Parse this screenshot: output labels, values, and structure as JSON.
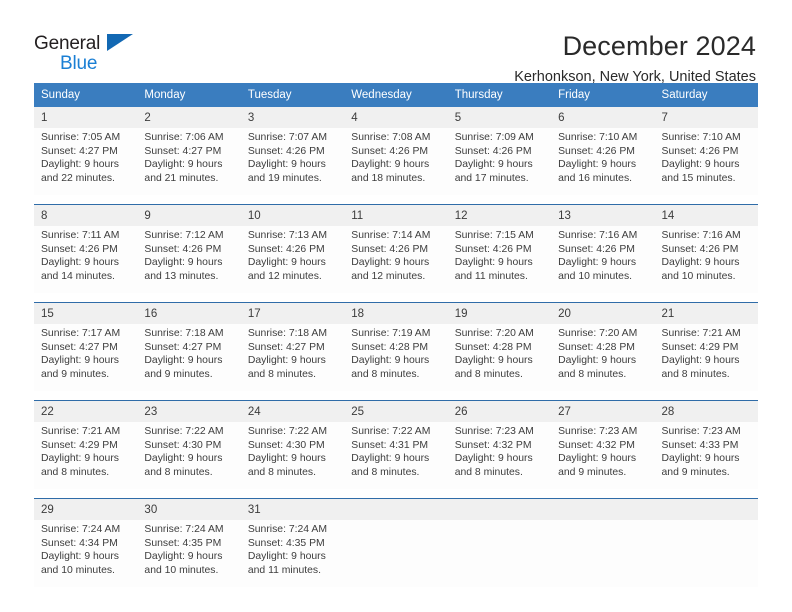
{
  "logo": {
    "line1": "General",
    "line2": "Blue",
    "triangle_color": "#1268b3"
  },
  "header": {
    "title": "December 2024",
    "location": "Kerhonkson, New York, United States"
  },
  "colors": {
    "header_blue": "#3a7dbf",
    "row_divider": "#2f6ca8",
    "daynum_band": "#f0f0f0",
    "text": "#3d3d3d"
  },
  "calendar": {
    "weekday_headers": [
      "Sunday",
      "Monday",
      "Tuesday",
      "Wednesday",
      "Thursday",
      "Friday",
      "Saturday"
    ],
    "weeks": [
      [
        {
          "day": "1",
          "sunrise": "Sunrise: 7:05 AM",
          "sunset": "Sunset: 4:27 PM",
          "daylight1": "Daylight: 9 hours",
          "daylight2": "and 22 minutes."
        },
        {
          "day": "2",
          "sunrise": "Sunrise: 7:06 AM",
          "sunset": "Sunset: 4:27 PM",
          "daylight1": "Daylight: 9 hours",
          "daylight2": "and 21 minutes."
        },
        {
          "day": "3",
          "sunrise": "Sunrise: 7:07 AM",
          "sunset": "Sunset: 4:26 PM",
          "daylight1": "Daylight: 9 hours",
          "daylight2": "and 19 minutes."
        },
        {
          "day": "4",
          "sunrise": "Sunrise: 7:08 AM",
          "sunset": "Sunset: 4:26 PM",
          "daylight1": "Daylight: 9 hours",
          "daylight2": "and 18 minutes."
        },
        {
          "day": "5",
          "sunrise": "Sunrise: 7:09 AM",
          "sunset": "Sunset: 4:26 PM",
          "daylight1": "Daylight: 9 hours",
          "daylight2": "and 17 minutes."
        },
        {
          "day": "6",
          "sunrise": "Sunrise: 7:10 AM",
          "sunset": "Sunset: 4:26 PM",
          "daylight1": "Daylight: 9 hours",
          "daylight2": "and 16 minutes."
        },
        {
          "day": "7",
          "sunrise": "Sunrise: 7:10 AM",
          "sunset": "Sunset: 4:26 PM",
          "daylight1": "Daylight: 9 hours",
          "daylight2": "and 15 minutes."
        }
      ],
      [
        {
          "day": "8",
          "sunrise": "Sunrise: 7:11 AM",
          "sunset": "Sunset: 4:26 PM",
          "daylight1": "Daylight: 9 hours",
          "daylight2": "and 14 minutes."
        },
        {
          "day": "9",
          "sunrise": "Sunrise: 7:12 AM",
          "sunset": "Sunset: 4:26 PM",
          "daylight1": "Daylight: 9 hours",
          "daylight2": "and 13 minutes."
        },
        {
          "day": "10",
          "sunrise": "Sunrise: 7:13 AM",
          "sunset": "Sunset: 4:26 PM",
          "daylight1": "Daylight: 9 hours",
          "daylight2": "and 12 minutes."
        },
        {
          "day": "11",
          "sunrise": "Sunrise: 7:14 AM",
          "sunset": "Sunset: 4:26 PM",
          "daylight1": "Daylight: 9 hours",
          "daylight2": "and 12 minutes."
        },
        {
          "day": "12",
          "sunrise": "Sunrise: 7:15 AM",
          "sunset": "Sunset: 4:26 PM",
          "daylight1": "Daylight: 9 hours",
          "daylight2": "and 11 minutes."
        },
        {
          "day": "13",
          "sunrise": "Sunrise: 7:16 AM",
          "sunset": "Sunset: 4:26 PM",
          "daylight1": "Daylight: 9 hours",
          "daylight2": "and 10 minutes."
        },
        {
          "day": "14",
          "sunrise": "Sunrise: 7:16 AM",
          "sunset": "Sunset: 4:26 PM",
          "daylight1": "Daylight: 9 hours",
          "daylight2": "and 10 minutes."
        }
      ],
      [
        {
          "day": "15",
          "sunrise": "Sunrise: 7:17 AM",
          "sunset": "Sunset: 4:27 PM",
          "daylight1": "Daylight: 9 hours",
          "daylight2": "and 9 minutes."
        },
        {
          "day": "16",
          "sunrise": "Sunrise: 7:18 AM",
          "sunset": "Sunset: 4:27 PM",
          "daylight1": "Daylight: 9 hours",
          "daylight2": "and 9 minutes."
        },
        {
          "day": "17",
          "sunrise": "Sunrise: 7:18 AM",
          "sunset": "Sunset: 4:27 PM",
          "daylight1": "Daylight: 9 hours",
          "daylight2": "and 8 minutes."
        },
        {
          "day": "18",
          "sunrise": "Sunrise: 7:19 AM",
          "sunset": "Sunset: 4:28 PM",
          "daylight1": "Daylight: 9 hours",
          "daylight2": "and 8 minutes."
        },
        {
          "day": "19",
          "sunrise": "Sunrise: 7:20 AM",
          "sunset": "Sunset: 4:28 PM",
          "daylight1": "Daylight: 9 hours",
          "daylight2": "and 8 minutes."
        },
        {
          "day": "20",
          "sunrise": "Sunrise: 7:20 AM",
          "sunset": "Sunset: 4:28 PM",
          "daylight1": "Daylight: 9 hours",
          "daylight2": "and 8 minutes."
        },
        {
          "day": "21",
          "sunrise": "Sunrise: 7:21 AM",
          "sunset": "Sunset: 4:29 PM",
          "daylight1": "Daylight: 9 hours",
          "daylight2": "and 8 minutes."
        }
      ],
      [
        {
          "day": "22",
          "sunrise": "Sunrise: 7:21 AM",
          "sunset": "Sunset: 4:29 PM",
          "daylight1": "Daylight: 9 hours",
          "daylight2": "and 8 minutes."
        },
        {
          "day": "23",
          "sunrise": "Sunrise: 7:22 AM",
          "sunset": "Sunset: 4:30 PM",
          "daylight1": "Daylight: 9 hours",
          "daylight2": "and 8 minutes."
        },
        {
          "day": "24",
          "sunrise": "Sunrise: 7:22 AM",
          "sunset": "Sunset: 4:30 PM",
          "daylight1": "Daylight: 9 hours",
          "daylight2": "and 8 minutes."
        },
        {
          "day": "25",
          "sunrise": "Sunrise: 7:22 AM",
          "sunset": "Sunset: 4:31 PM",
          "daylight1": "Daylight: 9 hours",
          "daylight2": "and 8 minutes."
        },
        {
          "day": "26",
          "sunrise": "Sunrise: 7:23 AM",
          "sunset": "Sunset: 4:32 PM",
          "daylight1": "Daylight: 9 hours",
          "daylight2": "and 8 minutes."
        },
        {
          "day": "27",
          "sunrise": "Sunrise: 7:23 AM",
          "sunset": "Sunset: 4:32 PM",
          "daylight1": "Daylight: 9 hours",
          "daylight2": "and 9 minutes."
        },
        {
          "day": "28",
          "sunrise": "Sunrise: 7:23 AM",
          "sunset": "Sunset: 4:33 PM",
          "daylight1": "Daylight: 9 hours",
          "daylight2": "and 9 minutes."
        }
      ],
      [
        {
          "day": "29",
          "sunrise": "Sunrise: 7:24 AM",
          "sunset": "Sunset: 4:34 PM",
          "daylight1": "Daylight: 9 hours",
          "daylight2": "and 10 minutes."
        },
        {
          "day": "30",
          "sunrise": "Sunrise: 7:24 AM",
          "sunset": "Sunset: 4:35 PM",
          "daylight1": "Daylight: 9 hours",
          "daylight2": "and 10 minutes."
        },
        {
          "day": "31",
          "sunrise": "Sunrise: 7:24 AM",
          "sunset": "Sunset: 4:35 PM",
          "daylight1": "Daylight: 9 hours",
          "daylight2": "and 11 minutes."
        },
        {
          "day": "",
          "sunrise": "",
          "sunset": "",
          "daylight1": "",
          "daylight2": ""
        },
        {
          "day": "",
          "sunrise": "",
          "sunset": "",
          "daylight1": "",
          "daylight2": ""
        },
        {
          "day": "",
          "sunrise": "",
          "sunset": "",
          "daylight1": "",
          "daylight2": ""
        },
        {
          "day": "",
          "sunrise": "",
          "sunset": "",
          "daylight1": "",
          "daylight2": ""
        }
      ]
    ]
  }
}
